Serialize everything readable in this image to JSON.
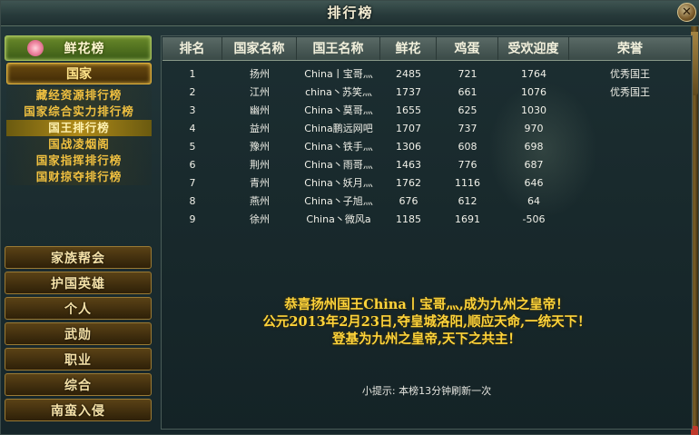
{
  "window": {
    "title": "排行榜"
  },
  "sidebar": {
    "tab_label": "鲜花榜",
    "section_label": "国家",
    "sub_items": [
      {
        "label": "藏经资源排行榜",
        "active": false
      },
      {
        "label": "国家综合实力排行榜",
        "active": false
      },
      {
        "label": "国王排行榜",
        "active": true
      },
      {
        "label": "国战凌烟阁",
        "active": false
      },
      {
        "label": "国家指挥排行榜",
        "active": false
      },
      {
        "label": "国财掠夺排行榜",
        "active": false
      }
    ],
    "menu_buttons": [
      "家族帮会",
      "护国英雄",
      "个人",
      "武勋",
      "职业",
      "综合",
      "南蛮入侵"
    ]
  },
  "table": {
    "headers": [
      "排名",
      "国家名称",
      "国王名称",
      "鲜花",
      "鸡蛋",
      "受欢迎度",
      "荣誉"
    ],
    "rows": [
      [
        "1",
        "扬州",
        "China丨宝哥灬",
        "2485",
        "721",
        "1764",
        "优秀国王"
      ],
      [
        "2",
        "江州",
        "china丶苏笑灬",
        "1737",
        "661",
        "1076",
        "优秀国王"
      ],
      [
        "3",
        "幽州",
        "China丶莫哥灬",
        "1655",
        "625",
        "1030",
        ""
      ],
      [
        "4",
        "益州",
        "China鹏远网吧",
        "1707",
        "737",
        "970",
        ""
      ],
      [
        "5",
        "豫州",
        "China丶铁手灬",
        "1306",
        "608",
        "698",
        ""
      ],
      [
        "6",
        "荆州",
        "China丶雨哥灬",
        "1463",
        "776",
        "687",
        ""
      ],
      [
        "7",
        "青州",
        "China丶妖月灬",
        "1762",
        "1116",
        "646",
        ""
      ],
      [
        "8",
        "燕州",
        "China丶子旭灬",
        "676",
        "612",
        "64",
        ""
      ],
      [
        "9",
        "徐州",
        "China丶微风a",
        "1185",
        "1691",
        "-506",
        ""
      ]
    ]
  },
  "announcement": [
    "恭喜扬州国王China丨宝哥灬,成为九州之皇帝！",
    "公元2013年2月23日,夺皇城洛阳,顺应天命,一统天下！",
    "登基为九州之皇帝,天下之共主！"
  ],
  "hint": "小提示: 本榜13分钟刷新一次",
  "icons": {
    "close": "close-icon",
    "flower": "flower-icon"
  }
}
